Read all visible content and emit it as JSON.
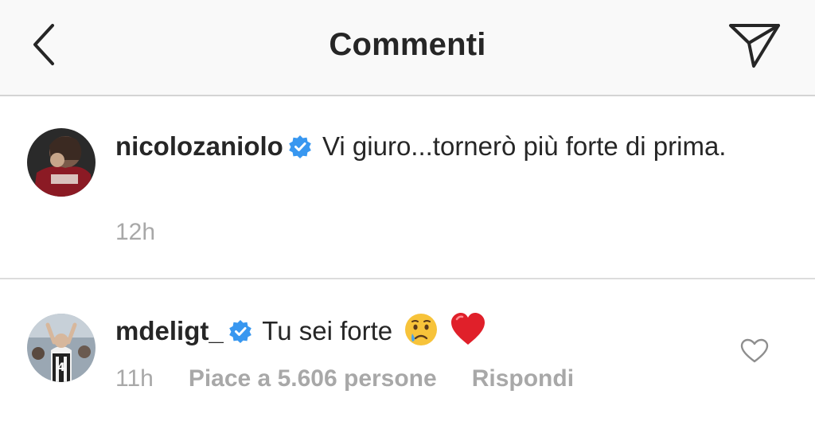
{
  "header": {
    "title": "Commenti",
    "back_icon": "chevron-left-icon",
    "send_icon": "paper-plane-icon"
  },
  "caption": {
    "username": "nicolozaniolo",
    "text": "Vi giuro...tornerò più forte di prima.",
    "time": "12h",
    "verified": true
  },
  "comments": [
    {
      "username": "mdeligt_",
      "text": "Tu sei forte",
      "emojis": [
        "crying-face",
        "red-heart"
      ],
      "time": "11h",
      "likes": "Piace a 5.606 persone",
      "reply": "Rispondi",
      "verified": true
    }
  ],
  "colors": {
    "verified": "#3897f0",
    "meta_text": "#a8a8a8",
    "heart": "#e0202a",
    "header_bg": "#f9f9f9"
  }
}
